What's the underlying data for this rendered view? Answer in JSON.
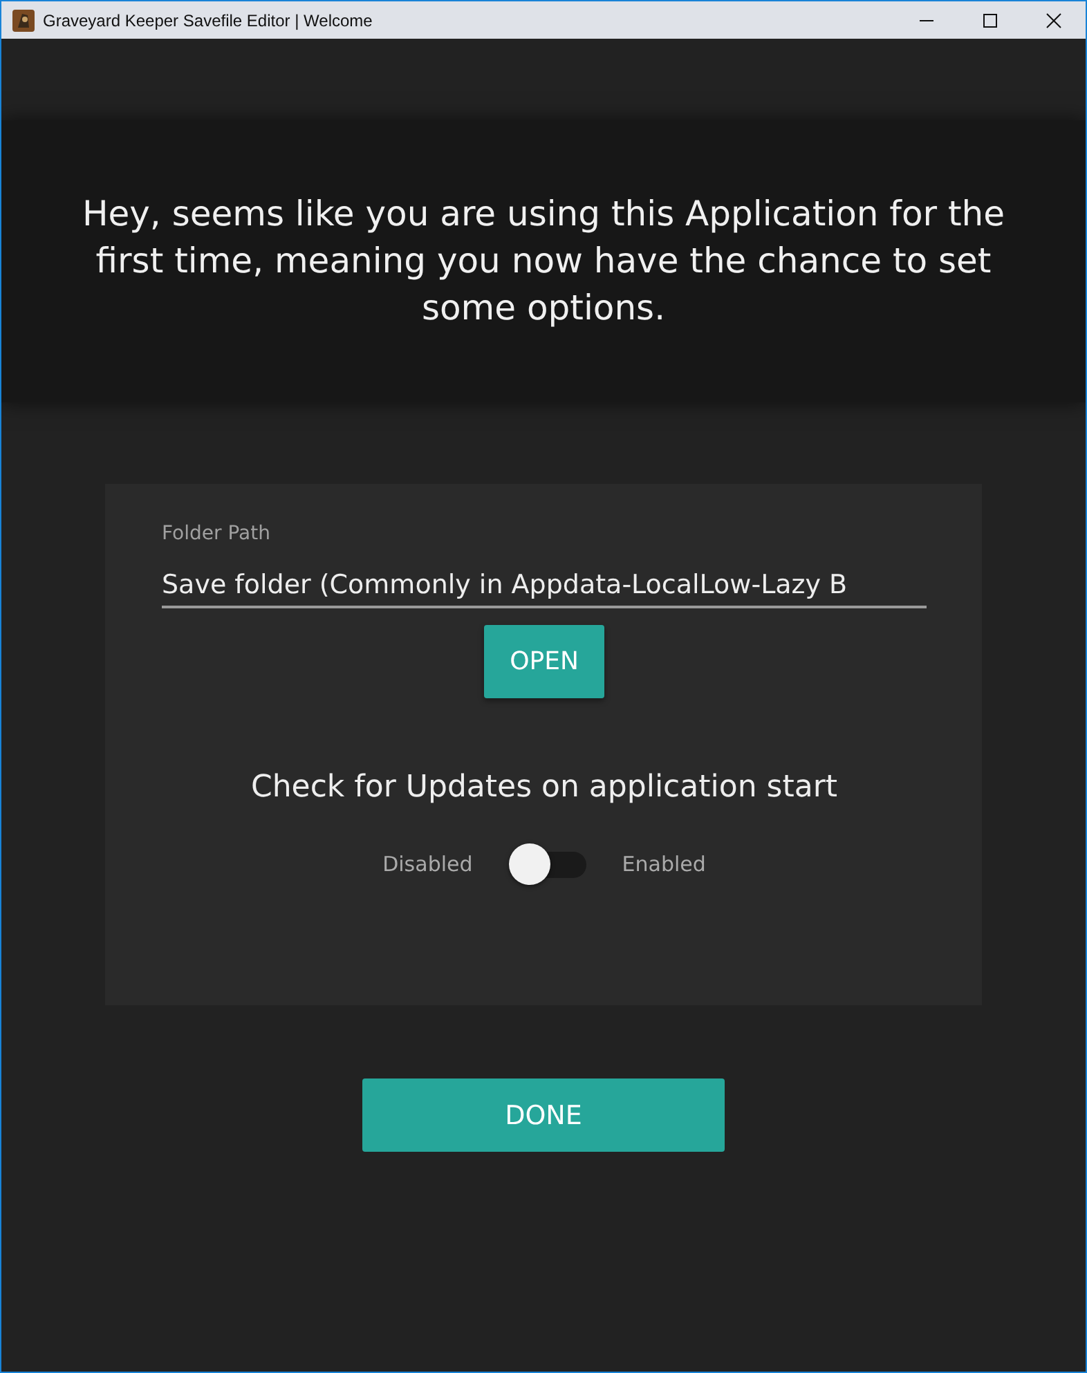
{
  "window": {
    "title": "Graveyard Keeper Savefile Editor | Welcome"
  },
  "banner": {
    "text": "Hey, seems like you are using this Application for the first time, meaning you now have the chance to set some options."
  },
  "folder": {
    "label": "Folder Path",
    "value": "Save folder (Commonly in Appdata-LocalLow-Lazy B",
    "button": "OPEN"
  },
  "updates": {
    "heading": "Check for Updates on application start",
    "off_label": "Disabled",
    "on_label": "Enabled",
    "on": false
  },
  "done_button": "DONE"
}
